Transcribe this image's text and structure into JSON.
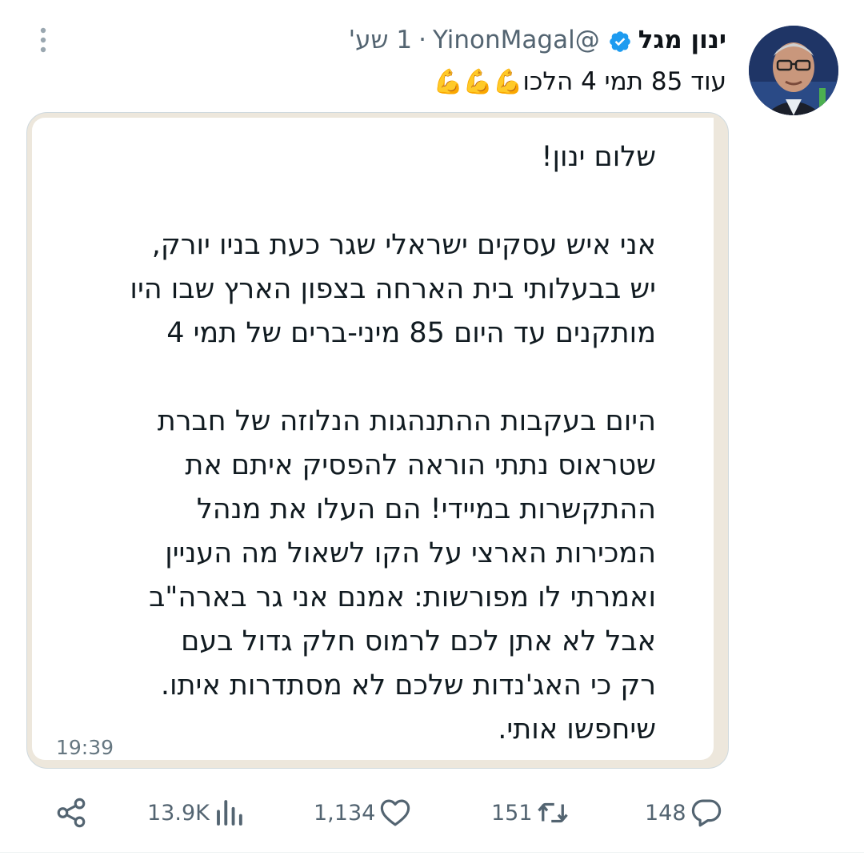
{
  "tweet": {
    "author_name": "ינון מגל",
    "handle": "@YinonMagal",
    "separator": "·",
    "time": "1 שע'",
    "text": "עוד 85 תמי 4 הלכו",
    "emoji": "💪💪💪",
    "icons": [
      "verified-badge-icon",
      "more-options-icon"
    ]
  },
  "media": {
    "message_lines": [
      "שלום ינון!",
      "",
      "אני איש עסקים ישראלי שגר כעת בניו יורק,",
      "יש בבעלותי בית הארחה בצפון הארץ שבו היו",
      "מותקנים עד היום 85 מיני-ברים של תמי 4",
      "",
      "היום בעקבות ההתנהגות הנלוזה של חברת",
      "שטראוס נתתי הוראה להפסיק איתם את",
      "ההתקשרות במיידי! הם העלו את מנהל",
      "המכירות הארצי על הקו לשאול מה העניין",
      "ואמרתי לו מפורשות: אמנם אני גר בארה\"ב",
      "אבל לא אתן לכם לרמוס חלק גדול בעם",
      "רק כי האג'נדות שלכם לא מסתדרות איתו.",
      "שיחפשו אותי."
    ],
    "timestamp": "19:39"
  },
  "actions": {
    "replies": "148",
    "retweets": "151",
    "likes": "1,134",
    "views": "13.9K"
  },
  "colors": {
    "verified_blue": "#1d9bf0",
    "secondary_text": "#536471",
    "chat_background": "#ede7dc"
  }
}
